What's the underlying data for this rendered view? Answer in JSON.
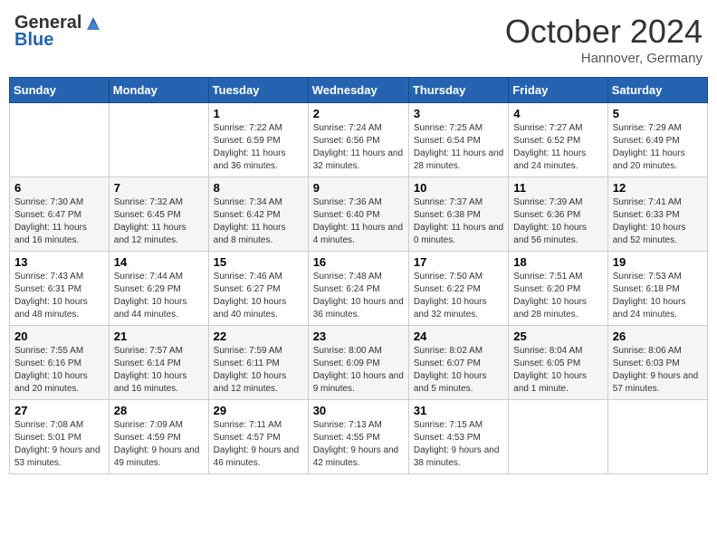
{
  "header": {
    "logo_general": "General",
    "logo_blue": "Blue",
    "month_title": "October 2024",
    "subtitle": "Hannover, Germany"
  },
  "days_of_week": [
    "Sunday",
    "Monday",
    "Tuesday",
    "Wednesday",
    "Thursday",
    "Friday",
    "Saturday"
  ],
  "weeks": [
    [
      {
        "day": "",
        "info": ""
      },
      {
        "day": "",
        "info": ""
      },
      {
        "day": "1",
        "info": "Sunrise: 7:22 AM\nSunset: 6:59 PM\nDaylight: 11 hours and 36 minutes."
      },
      {
        "day": "2",
        "info": "Sunrise: 7:24 AM\nSunset: 6:56 PM\nDaylight: 11 hours and 32 minutes."
      },
      {
        "day": "3",
        "info": "Sunrise: 7:25 AM\nSunset: 6:54 PM\nDaylight: 11 hours and 28 minutes."
      },
      {
        "day": "4",
        "info": "Sunrise: 7:27 AM\nSunset: 6:52 PM\nDaylight: 11 hours and 24 minutes."
      },
      {
        "day": "5",
        "info": "Sunrise: 7:29 AM\nSunset: 6:49 PM\nDaylight: 11 hours and 20 minutes."
      }
    ],
    [
      {
        "day": "6",
        "info": "Sunrise: 7:30 AM\nSunset: 6:47 PM\nDaylight: 11 hours and 16 minutes."
      },
      {
        "day": "7",
        "info": "Sunrise: 7:32 AM\nSunset: 6:45 PM\nDaylight: 11 hours and 12 minutes."
      },
      {
        "day": "8",
        "info": "Sunrise: 7:34 AM\nSunset: 6:42 PM\nDaylight: 11 hours and 8 minutes."
      },
      {
        "day": "9",
        "info": "Sunrise: 7:36 AM\nSunset: 6:40 PM\nDaylight: 11 hours and 4 minutes."
      },
      {
        "day": "10",
        "info": "Sunrise: 7:37 AM\nSunset: 6:38 PM\nDaylight: 11 hours and 0 minutes."
      },
      {
        "day": "11",
        "info": "Sunrise: 7:39 AM\nSunset: 6:36 PM\nDaylight: 10 hours and 56 minutes."
      },
      {
        "day": "12",
        "info": "Sunrise: 7:41 AM\nSunset: 6:33 PM\nDaylight: 10 hours and 52 minutes."
      }
    ],
    [
      {
        "day": "13",
        "info": "Sunrise: 7:43 AM\nSunset: 6:31 PM\nDaylight: 10 hours and 48 minutes."
      },
      {
        "day": "14",
        "info": "Sunrise: 7:44 AM\nSunset: 6:29 PM\nDaylight: 10 hours and 44 minutes."
      },
      {
        "day": "15",
        "info": "Sunrise: 7:46 AM\nSunset: 6:27 PM\nDaylight: 10 hours and 40 minutes."
      },
      {
        "day": "16",
        "info": "Sunrise: 7:48 AM\nSunset: 6:24 PM\nDaylight: 10 hours and 36 minutes."
      },
      {
        "day": "17",
        "info": "Sunrise: 7:50 AM\nSunset: 6:22 PM\nDaylight: 10 hours and 32 minutes."
      },
      {
        "day": "18",
        "info": "Sunrise: 7:51 AM\nSunset: 6:20 PM\nDaylight: 10 hours and 28 minutes."
      },
      {
        "day": "19",
        "info": "Sunrise: 7:53 AM\nSunset: 6:18 PM\nDaylight: 10 hours and 24 minutes."
      }
    ],
    [
      {
        "day": "20",
        "info": "Sunrise: 7:55 AM\nSunset: 6:16 PM\nDaylight: 10 hours and 20 minutes."
      },
      {
        "day": "21",
        "info": "Sunrise: 7:57 AM\nSunset: 6:14 PM\nDaylight: 10 hours and 16 minutes."
      },
      {
        "day": "22",
        "info": "Sunrise: 7:59 AM\nSunset: 6:11 PM\nDaylight: 10 hours and 12 minutes."
      },
      {
        "day": "23",
        "info": "Sunrise: 8:00 AM\nSunset: 6:09 PM\nDaylight: 10 hours and 9 minutes."
      },
      {
        "day": "24",
        "info": "Sunrise: 8:02 AM\nSunset: 6:07 PM\nDaylight: 10 hours and 5 minutes."
      },
      {
        "day": "25",
        "info": "Sunrise: 8:04 AM\nSunset: 6:05 PM\nDaylight: 10 hours and 1 minute."
      },
      {
        "day": "26",
        "info": "Sunrise: 8:06 AM\nSunset: 6:03 PM\nDaylight: 9 hours and 57 minutes."
      }
    ],
    [
      {
        "day": "27",
        "info": "Sunrise: 7:08 AM\nSunset: 5:01 PM\nDaylight: 9 hours and 53 minutes."
      },
      {
        "day": "28",
        "info": "Sunrise: 7:09 AM\nSunset: 4:59 PM\nDaylight: 9 hours and 49 minutes."
      },
      {
        "day": "29",
        "info": "Sunrise: 7:11 AM\nSunset: 4:57 PM\nDaylight: 9 hours and 46 minutes."
      },
      {
        "day": "30",
        "info": "Sunrise: 7:13 AM\nSunset: 4:55 PM\nDaylight: 9 hours and 42 minutes."
      },
      {
        "day": "31",
        "info": "Sunrise: 7:15 AM\nSunset: 4:53 PM\nDaylight: 9 hours and 38 minutes."
      },
      {
        "day": "",
        "info": ""
      },
      {
        "day": "",
        "info": ""
      }
    ]
  ]
}
